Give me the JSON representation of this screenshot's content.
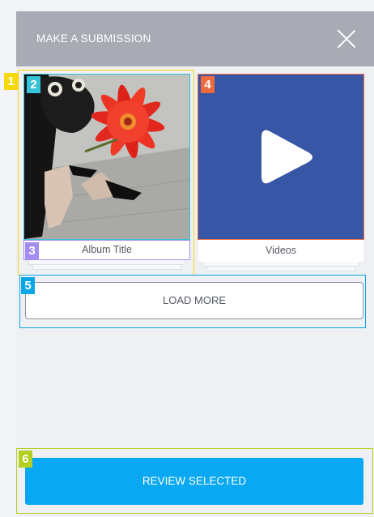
{
  "header": {
    "title": "MAKE A SUBMISSION",
    "close_icon": "close-icon"
  },
  "tiles": [
    {
      "caption": "Album Title",
      "type": "album"
    },
    {
      "caption": "Videos",
      "type": "videos",
      "icon": "play-icon"
    }
  ],
  "load_more": {
    "label": "LOAD MORE"
  },
  "review": {
    "label": "REVIEW SELECTED"
  },
  "annotations": [
    {
      "label": "1",
      "color": "#f5d90a"
    },
    {
      "label": "2",
      "color": "#34c3d8"
    },
    {
      "label": "3",
      "color": "#a38cf2"
    },
    {
      "label": "4",
      "color": "#ef6a3e"
    },
    {
      "label": "5",
      "color": "#0aa6e8"
    },
    {
      "label": "6",
      "color": "#b3cf1f"
    }
  ],
  "colors": {
    "header": "#a9abb4",
    "accent": "#08a8f2",
    "video_tile": "#3856a6"
  }
}
